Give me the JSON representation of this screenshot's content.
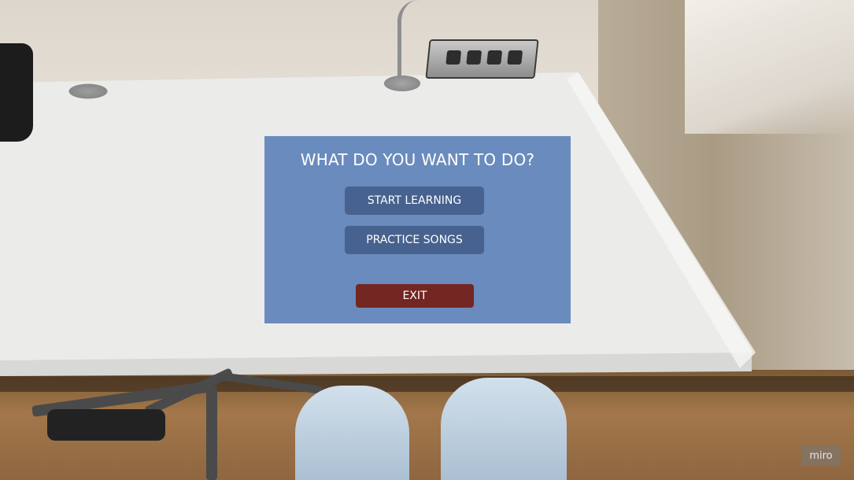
{
  "menu": {
    "title": "WHAT DO YOU WANT TO DO?",
    "start_label": "START LEARNING",
    "practice_label": "PRACTICE SONGS",
    "exit_label": "EXIT"
  },
  "watermark": {
    "text": "miro"
  },
  "colors": {
    "panel": "#6a8bbd",
    "primary_button": "#47628f",
    "exit_button": "#732622",
    "text": "#ffffff"
  }
}
